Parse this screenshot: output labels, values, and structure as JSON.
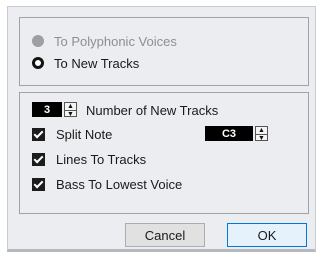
{
  "output_options": {
    "polyphonic_voices_label": "To Polyphonic Voices",
    "new_tracks_label": "To New Tracks",
    "selected": "To New Tracks"
  },
  "settings": {
    "number_of_new_tracks": {
      "value": "3",
      "label": "Number of New Tracks"
    },
    "split_note": {
      "label": "Split Note",
      "checked": true,
      "value": "C3"
    },
    "lines_to_tracks": {
      "label": "Lines To Tracks",
      "checked": true
    },
    "bass_to_lowest_voice": {
      "label": "Bass To Lowest Voice",
      "checked": true
    }
  },
  "buttons": {
    "cancel": "Cancel",
    "ok": "OK"
  },
  "icons": {
    "spin_up": "▲",
    "spin_down": "▼"
  }
}
